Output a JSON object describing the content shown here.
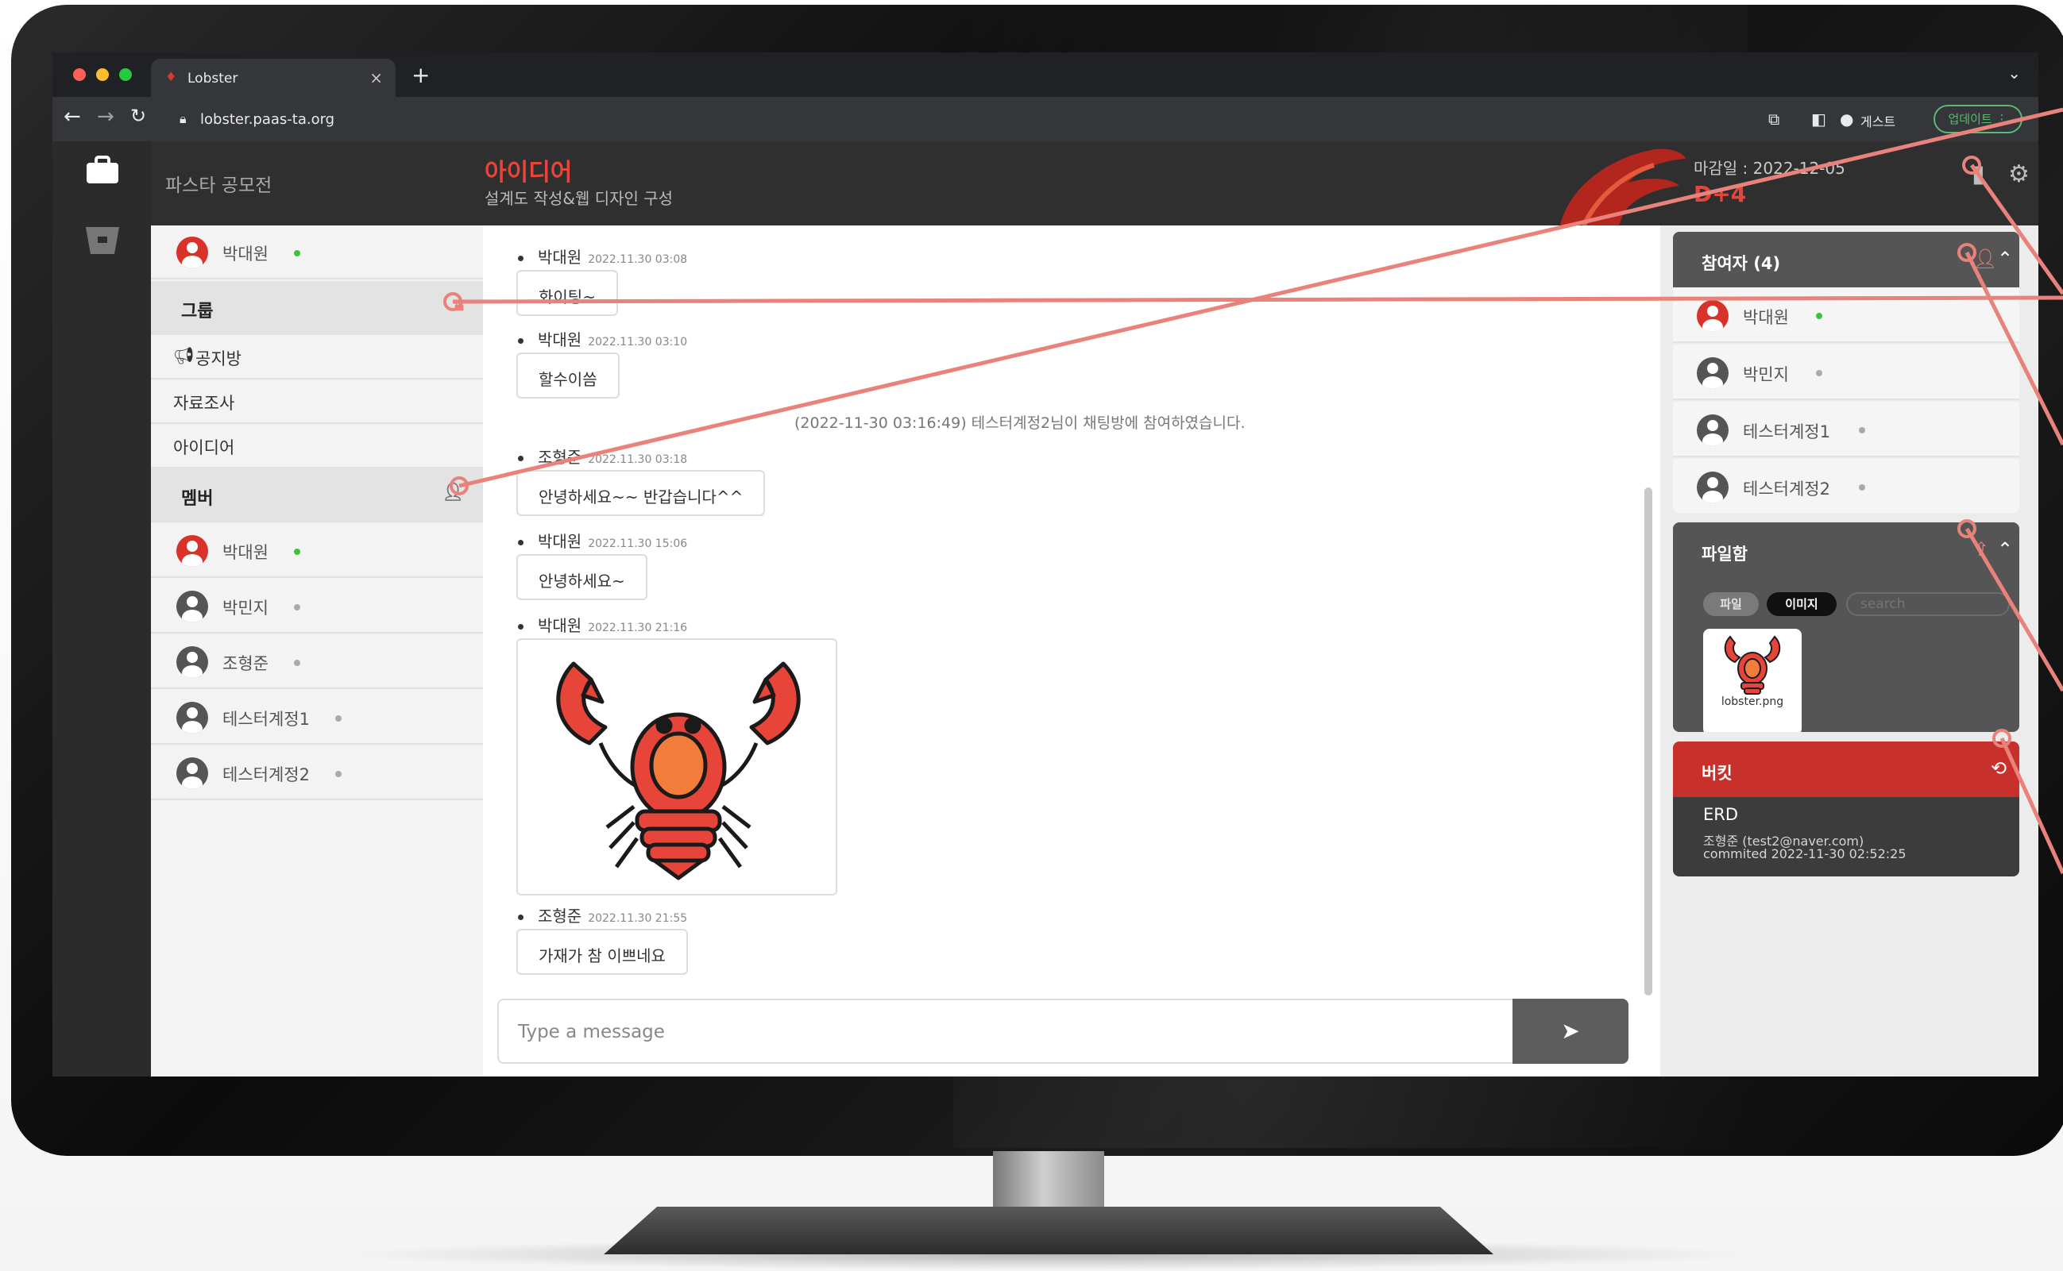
{
  "colors": {
    "accent": "#e5453b",
    "online": "#3ac43a",
    "offline": "#aaaaaa",
    "annotation": "#e8827b"
  },
  "browser": {
    "tab_title": "Lobster",
    "url": "lobster.paas-ta.org",
    "profile_label": "게스트",
    "update_label": "업데이트"
  },
  "header": {
    "org_name": "파스타 공모전",
    "channel_title": "아이디어",
    "channel_subtitle": "설계도 작성&웹 디자인 구성",
    "deadline": "마감일 : 2022-12-05",
    "dday": "D+4"
  },
  "sidebar": {
    "current_user": "박대원",
    "group_header": "그룹",
    "channels": [
      "공지방",
      "자료조사",
      "아이디어"
    ],
    "member_header": "멤버",
    "members": [
      {
        "name": "박대원",
        "online": true
      },
      {
        "name": "박민지",
        "online": false
      },
      {
        "name": "조형준",
        "online": false
      },
      {
        "name": "테스터계정1",
        "online": false
      },
      {
        "name": "테스터계정2",
        "online": false
      }
    ]
  },
  "chat": {
    "messages": [
      {
        "author": "박대원",
        "time": "2022.11.30 03:08",
        "text": "화이팅~"
      },
      {
        "author": "박대원",
        "time": "2022.11.30 03:10",
        "text": "할수이씀"
      },
      {
        "author": "조형준",
        "time": "2022.11.30 03:18",
        "text": "안녕하세요~~ 반갑습니다^^"
      },
      {
        "author": "박대원",
        "time": "2022.11.30 15:06",
        "text": "안녕하세요~"
      },
      {
        "author": "박대원",
        "time": "2022.11.30 21:16",
        "image": "lobster"
      },
      {
        "author": "조형준",
        "time": "2022.11.30 21:55",
        "text": "가재가 참 이쁘네요"
      }
    ],
    "system_message": "(2022-11-30 03:16:49) 테스터계정2님이 채팅방에 참여하였습니다.",
    "input_placeholder": "Type a message"
  },
  "participants": {
    "title": "참여자 (4)",
    "list": [
      {
        "name": "박대원",
        "online": true
      },
      {
        "name": "박민지",
        "online": false
      },
      {
        "name": "테스터계정1",
        "online": false
      },
      {
        "name": "테스터계정2",
        "online": false
      }
    ]
  },
  "files": {
    "title": "파일함",
    "tab_file": "파일",
    "tab_image": "이미지",
    "search_placeholder": "search",
    "items": [
      {
        "name": "lobster.png"
      }
    ]
  },
  "bucket": {
    "title": "버킷",
    "commit": {
      "title": "ERD",
      "author": "조형준 (test2@naver.com)",
      "committed": "commited 2022-11-30 02:52:25"
    }
  }
}
